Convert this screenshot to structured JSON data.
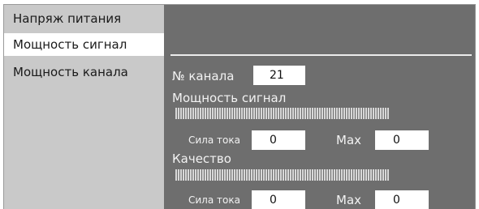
{
  "menu": {
    "items": [
      {
        "label": "Напряж питания"
      },
      {
        "label": "Мощность сигнал"
      },
      {
        "label": "Мощность канала"
      }
    ],
    "selected_index": 1
  },
  "panel": {
    "channel_label": "№ канала",
    "channel_value": "21",
    "signal_power": {
      "title": "Мощность сигнал",
      "current_label": "Сила тока",
      "current_value": "0",
      "max_label": "Max",
      "max_value": "0",
      "level": 0
    },
    "quality": {
      "title": "Качество",
      "current_label": "Сила тока",
      "current_value": "0",
      "max_label": "Max",
      "max_value": "0",
      "level": 0
    }
  },
  "colors": {
    "sidebar": "#c9c9c9",
    "panel": "#6e6e6e",
    "selected": "#ffffff"
  }
}
